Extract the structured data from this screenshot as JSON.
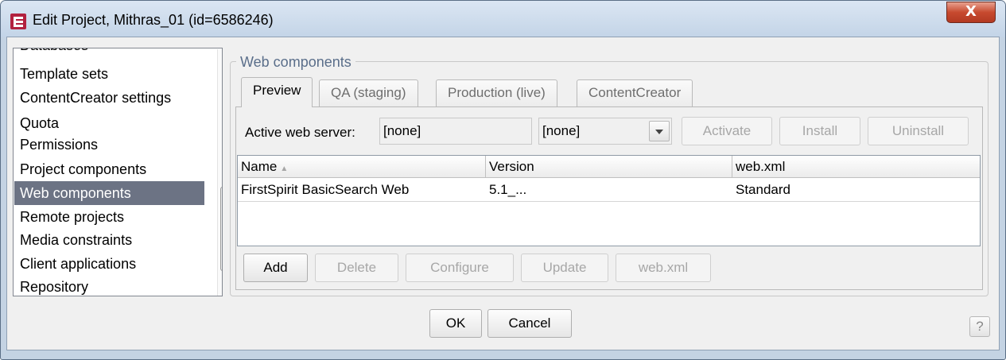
{
  "window": {
    "title": "Edit Project, Mithras_01 (id=6586246)",
    "close_label": "X"
  },
  "nav": {
    "items": [
      {
        "label": "Databases"
      },
      {
        "label": "Template sets"
      },
      {
        "label": "ContentCreator settings"
      },
      {
        "label": "Quota"
      },
      {
        "label": "Permissions"
      },
      {
        "label": "Project components"
      },
      {
        "label": "Web components"
      },
      {
        "label": "Remote projects"
      },
      {
        "label": "Media constraints"
      },
      {
        "label": "Client applications"
      },
      {
        "label": "Repository"
      }
    ],
    "selected": "Web components"
  },
  "group": {
    "legend": "Web components"
  },
  "tabs": [
    {
      "label": "Preview",
      "active": true
    },
    {
      "label": "QA (staging)",
      "active": false
    },
    {
      "label": "Production (live)",
      "active": false
    },
    {
      "label": "ContentCreator",
      "active": false
    }
  ],
  "server": {
    "label": "Active web server:",
    "value": "[none]",
    "select_value": "[none]",
    "buttons": {
      "activate": "Activate",
      "install": "Install",
      "uninstall": "Uninstall"
    }
  },
  "table": {
    "columns": [
      {
        "label": "Name"
      },
      {
        "label": "Version"
      },
      {
        "label": "web.xml"
      }
    ],
    "rows": [
      {
        "name": "FirstSpirit BasicSearch Web",
        "version": "5.1_...",
        "webxml": "Standard"
      }
    ]
  },
  "actions": {
    "add": "Add",
    "delete": "Delete",
    "configure": "Configure",
    "update": "Update",
    "webxml": "web.xml"
  },
  "footer": {
    "ok": "OK",
    "cancel": "Cancel",
    "help": "?"
  },
  "colors": {
    "selection": "#6c7384",
    "legend": "#5a6e8a",
    "close": "#c74a2f"
  }
}
